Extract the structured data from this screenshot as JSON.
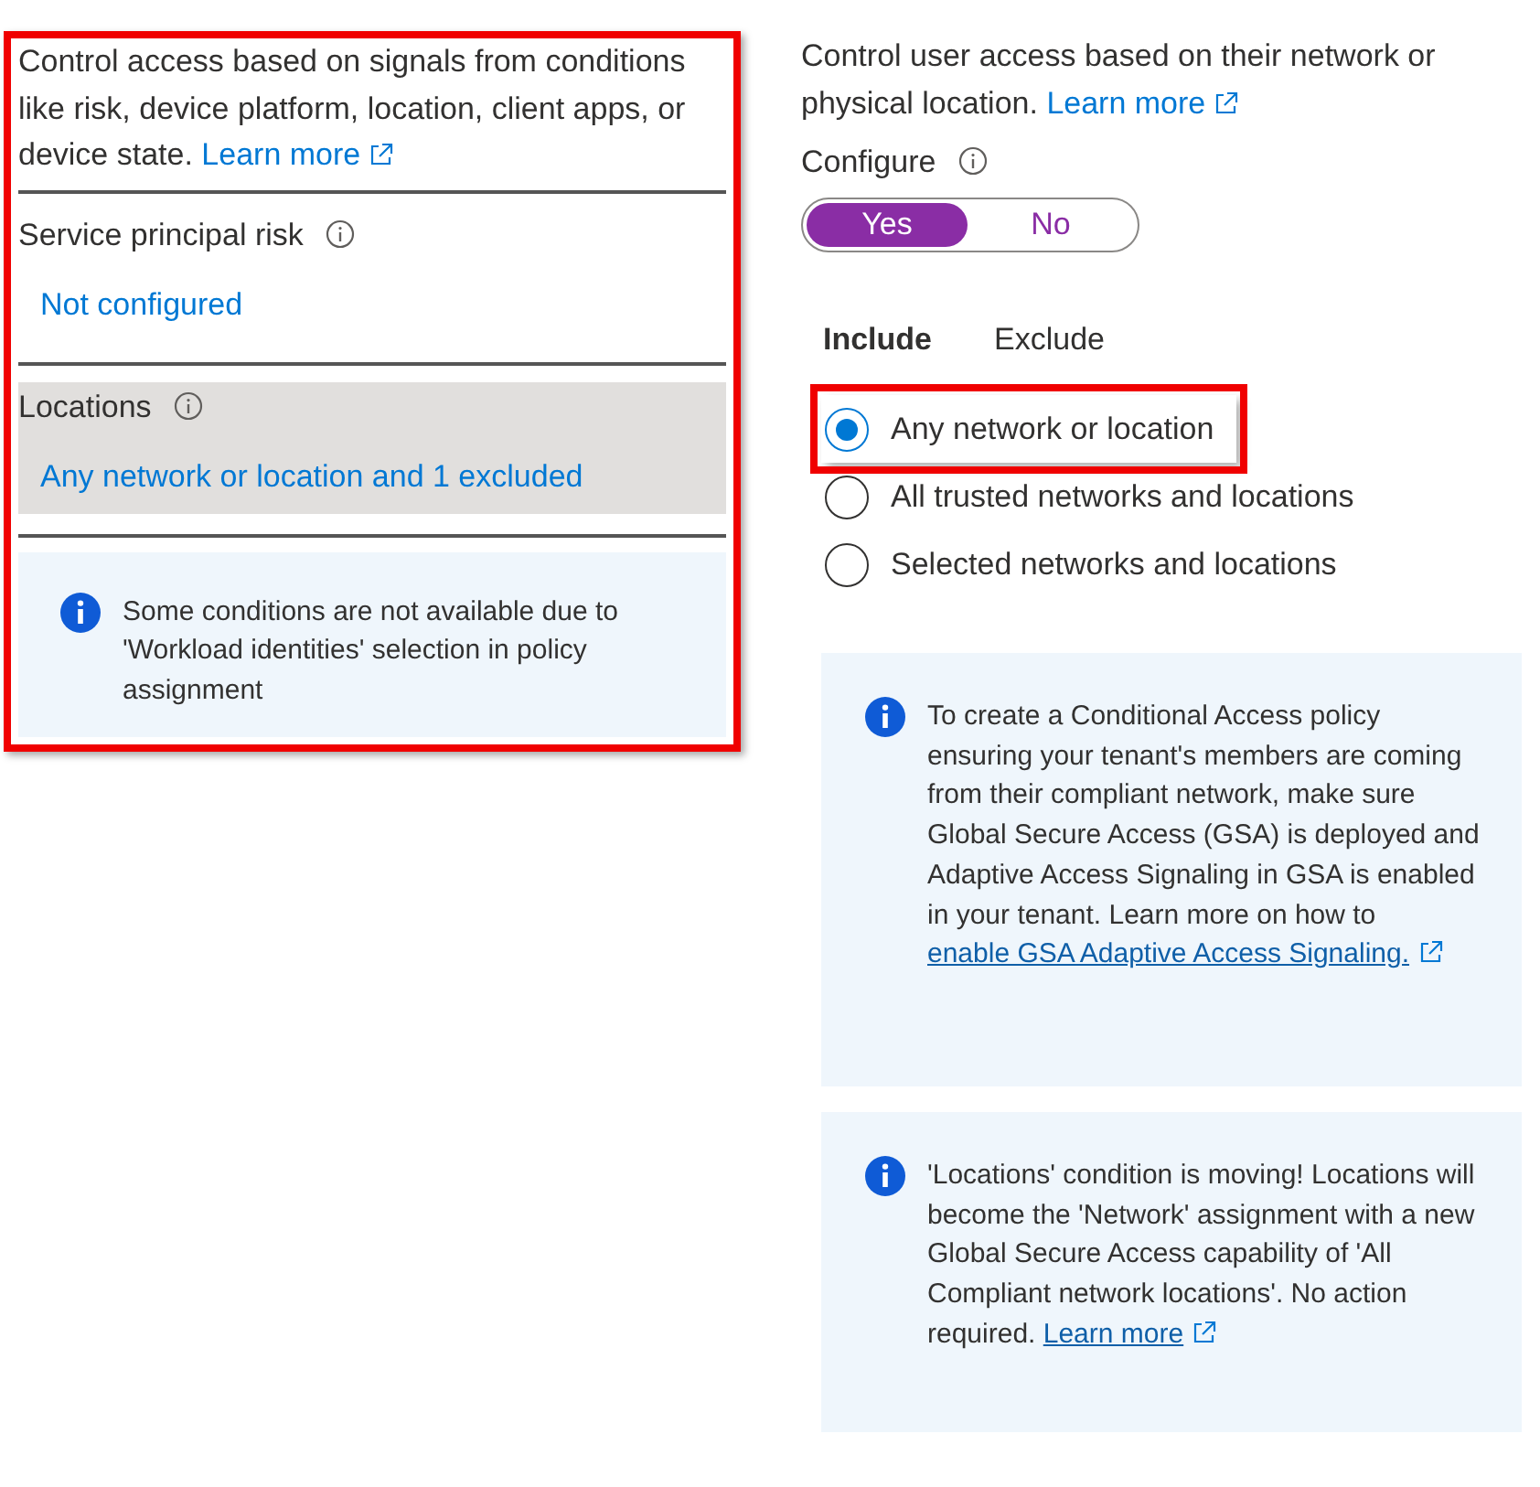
{
  "conditions_panel": {
    "highlighted": true,
    "description": "Control access based on signals from conditions like risk, device platform, location, client apps, or device state.",
    "learn_more": "Learn more",
    "conditions": [
      {
        "label": "Service principal risk",
        "value": "Not configured",
        "selected": false
      },
      {
        "label": "Locations",
        "value": "Any network or location and 1 excluded",
        "selected": true
      }
    ],
    "notice": "Some conditions are not available due to 'Workload identities' selection in policy assignment"
  },
  "locations_panel": {
    "description": "Control user access based on their network or physical location.",
    "learn_more": "Learn more",
    "configure": {
      "label": "Configure",
      "options": [
        {
          "label": "Yes",
          "selected": true
        },
        {
          "label": "No",
          "selected": false
        }
      ]
    },
    "tabs": [
      {
        "label": "Include",
        "selected": true
      },
      {
        "label": "Exclude",
        "selected": false
      }
    ],
    "options": [
      {
        "label": "Any network or location",
        "selected": true,
        "highlighted": true
      },
      {
        "label": "All trusted networks and locations",
        "selected": false,
        "highlighted": false
      },
      {
        "label": "Selected networks and locations",
        "selected": false,
        "highlighted": false
      }
    ],
    "notices": [
      {
        "text": "To create a Conditional Access policy ensuring your tenant's members are coming from their compliant network, make sure Global Secure Access (GSA) is deployed and Adaptive Access Signaling in GSA is enabled in your tenant. Learn more on how to",
        "link": "enable GSA Adaptive Access Signaling."
      },
      {
        "text": "'Locations' condition is moving! Locations will become the 'Network' assignment with a new Global Secure Access capability of 'All Compliant network locations'. No action required.",
        "link": "Learn more"
      }
    ]
  }
}
